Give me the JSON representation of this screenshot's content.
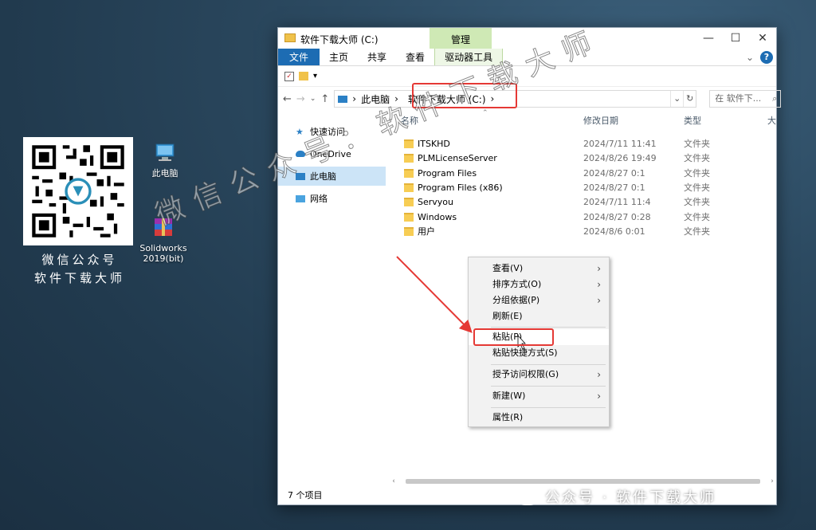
{
  "desktop": {
    "qr_caption_line1": "微信公众号",
    "qr_caption_line2": "软件下载大师",
    "icons": [
      {
        "label": "此电脑",
        "icon": "computer-icon"
      },
      {
        "label": "Solidworks\n2019(bit)",
        "icon": "winrar-archive-icon"
      }
    ]
  },
  "watermark": {
    "diagonal_text": "微信公众号：软件下载大师",
    "footer_text": "公众号 · 软件下载大师"
  },
  "window": {
    "title": "软件下载大师 (C:)",
    "context_tab_header": "管理",
    "controls": {
      "minimize": "—",
      "maximize": "☐",
      "close": "✕"
    },
    "ribbon_tabs": [
      "文件",
      "主页",
      "共享",
      "查看",
      "驱动器工具"
    ],
    "address": {
      "segments": [
        "此电脑",
        "软件下载大师 (C:)"
      ],
      "separator": "›"
    },
    "search_placeholder": "在 软件下... ",
    "nav_pane": [
      {
        "label": "快速访问",
        "icon": "star-icon",
        "selected": false
      },
      {
        "label": "OneDrive",
        "icon": "cloud-icon",
        "selected": false
      },
      {
        "label": "此电脑",
        "icon": "computer-icon",
        "selected": true
      },
      {
        "label": "网络",
        "icon": "network-icon",
        "selected": false
      }
    ],
    "columns": [
      "名称",
      "修改日期",
      "类型",
      "大"
    ],
    "files": [
      {
        "name": "ITSKHD",
        "date": "2024/7/11 11:41",
        "type": "文件夹"
      },
      {
        "name": "PLMLicenseServer",
        "date": "2024/8/26 19:49",
        "type": "文件夹"
      },
      {
        "name": "Program Files",
        "date": "2024/8/27 0:1",
        "type": "文件夹"
      },
      {
        "name": "Program Files (x86)",
        "date": "2024/8/27 0:1",
        "type": "文件夹"
      },
      {
        "name": "Servyou",
        "date": "2024/7/11 11:4",
        "type": "文件夹"
      },
      {
        "name": "Windows",
        "date": "2024/8/27 0:28",
        "type": "文件夹"
      },
      {
        "name": "用户",
        "date": "2024/8/6 0:01",
        "type": "文件夹"
      }
    ],
    "status": "7 个项目"
  },
  "context_menu": {
    "items": [
      {
        "label": "查看(V)",
        "submenu": true
      },
      {
        "label": "排序方式(O)",
        "submenu": true
      },
      {
        "label": "分组依据(P)",
        "submenu": true
      },
      {
        "label": "刷新(E)",
        "submenu": false
      },
      {
        "label": "粘贴(P)",
        "submenu": false
      },
      {
        "label": "粘贴快捷方式(S)",
        "submenu": false
      },
      {
        "label": "授予访问权限(G)",
        "submenu": true
      },
      {
        "label": "新建(W)",
        "submenu": true
      },
      {
        "label": "属性(R)",
        "submenu": false
      }
    ]
  },
  "colors": {
    "accent": "#1d6cb3",
    "highlight_red": "#e53935",
    "context_tab": "#cfe9b5"
  }
}
